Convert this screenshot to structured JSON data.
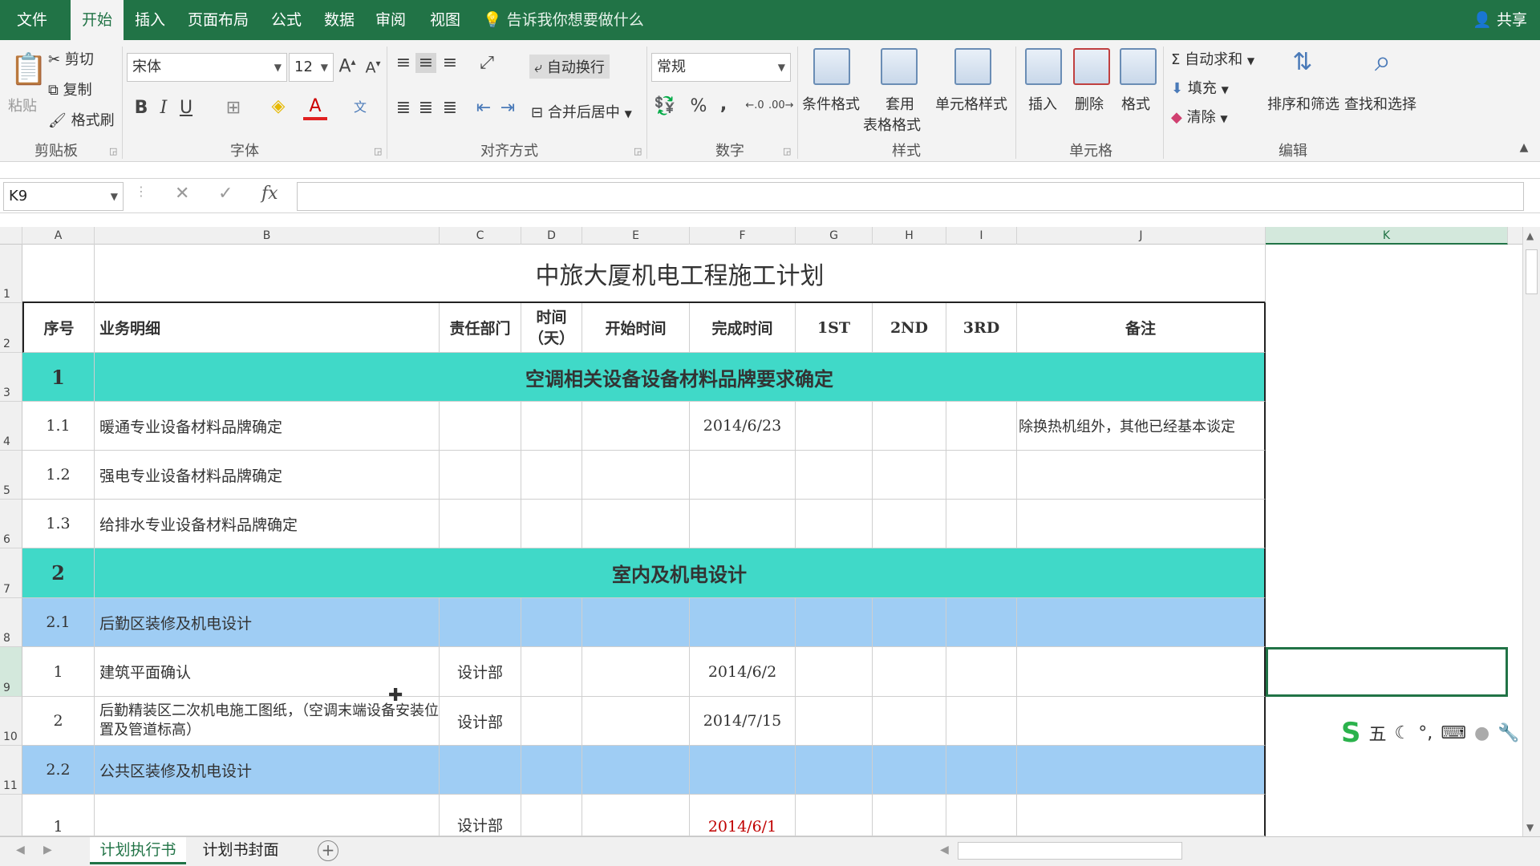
{
  "menu": {
    "file": "文件",
    "tabs": [
      "开始",
      "插入",
      "页面布局",
      "公式",
      "数据",
      "审阅",
      "视图"
    ],
    "tell_me": "告诉我你想要做什么",
    "share": "共享"
  },
  "ribbon": {
    "clipboard": {
      "paste": "粘贴",
      "cut": "剪切",
      "copy": "复制",
      "format_painter": "格式刷",
      "label": "剪贴板"
    },
    "font": {
      "name": "宋体",
      "size": "12",
      "bold": "B",
      "italic": "I",
      "underline": "U",
      "label": "字体"
    },
    "alignment": {
      "wrap_text": "自动换行",
      "merge_center": "合并后居中",
      "label": "对齐方式"
    },
    "number": {
      "format": "常规",
      "percent": "%",
      "comma": ",",
      "label": "数字"
    },
    "styles": {
      "conditional": "条件格式",
      "table_format_1": "套用",
      "table_format_2": "表格格式",
      "cell_styles": "单元格样式",
      "label": "样式"
    },
    "cells": {
      "insert": "插入",
      "delete": "删除",
      "format": "格式",
      "label": "单元格"
    },
    "editing": {
      "autosum": "自动求和",
      "fill": "填充",
      "clear": "清除",
      "sort_filter": "排序和筛选",
      "find_select": "查找和选择",
      "label": "编辑"
    }
  },
  "formula_bar": {
    "name_box": "K9",
    "fx": "fx",
    "value": ""
  },
  "columns": [
    "A",
    "B",
    "C",
    "D",
    "E",
    "F",
    "G",
    "H",
    "I",
    "J",
    "K"
  ],
  "rows": [
    "1",
    "2",
    "3",
    "4",
    "5",
    "6",
    "7",
    "8",
    "9",
    "10",
    "11"
  ],
  "sheet": {
    "title": "中旅大厦机电工程施工计划",
    "headers": [
      "序号",
      "业务明细",
      "责任部门",
      "时间（天）",
      "开始时间",
      "完成时间",
      "1ST",
      "2ND",
      "3RD",
      "备注"
    ],
    "section1": {
      "no": "1",
      "name": "空调相关设备设备材料品牌要求确定"
    },
    "r4": {
      "no": "1.1",
      "detail": "暖通专业设备材料品牌确定",
      "finish": "2014/6/23",
      "note": "除换热机组外，其他已经基本谈定"
    },
    "r5": {
      "no": "1.2",
      "detail": "强电专业设备材料品牌确定"
    },
    "r6": {
      "no": "1.3",
      "detail": "给排水专业设备材料品牌确定"
    },
    "section2": {
      "no": "2",
      "name": "室内及机电设计"
    },
    "r8": {
      "no": "2.1",
      "detail": "后勤区装修及机电设计"
    },
    "r9": {
      "no": "1",
      "detail": "建筑平面确认",
      "dept": "设计部",
      "finish": "2014/6/2"
    },
    "r10": {
      "no": "2",
      "detail": "后勤精装区二次机电施工图纸，（空调末端设备安装位置及管道标高）",
      "dept": "设计部",
      "finish": "2014/7/15"
    },
    "r11": {
      "no": "2.2",
      "detail": "公共区装修及机电设计"
    },
    "r12": {
      "no": "1",
      "dept": "设计部",
      "finish": "2014/6/1"
    }
  },
  "sheet_tabs": [
    "计划执行书",
    "计划书封面"
  ],
  "colors": {
    "excel_green": "#217346",
    "section_teal": "#40d9c8",
    "subsection_blue": "#9fcdf4"
  }
}
